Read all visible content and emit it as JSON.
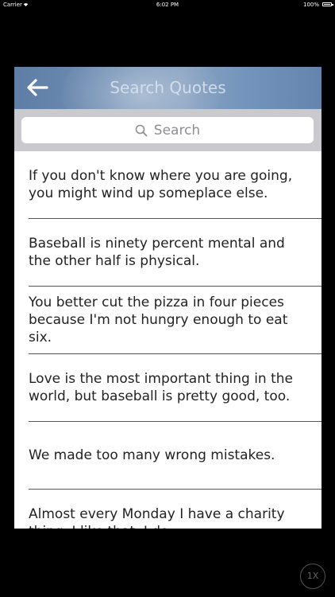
{
  "status_bar": {
    "carrier": "Carrier",
    "time": "6:02 PM",
    "battery": "100%",
    "wifi_icon": "wifi-icon",
    "battery_icon": "battery-icon"
  },
  "nav": {
    "title": "Search Quotes",
    "back_icon": "back-arrow-icon"
  },
  "search": {
    "placeholder": "Search",
    "icon": "search-icon"
  },
  "quotes": [
    {
      "text": "If you don't know where you are going, you might wind up someplace else."
    },
    {
      "text": "Baseball is ninety percent mental and the other half is physical."
    },
    {
      "text": "You better cut the pizza in four pieces because I'm not hungry enough to eat six."
    },
    {
      "text": "Love is the most important thing in the world, but baseball is pretty good, too."
    },
    {
      "text": "We made too many wrong mistakes."
    },
    {
      "text": "Almost every Monday I have a charity thing. I like that. I do."
    }
  ],
  "zoom_badge": "1X",
  "colors": {
    "nav_bar": "#6f8db3",
    "search_area": "#c9c9ce",
    "background": "#000000"
  }
}
